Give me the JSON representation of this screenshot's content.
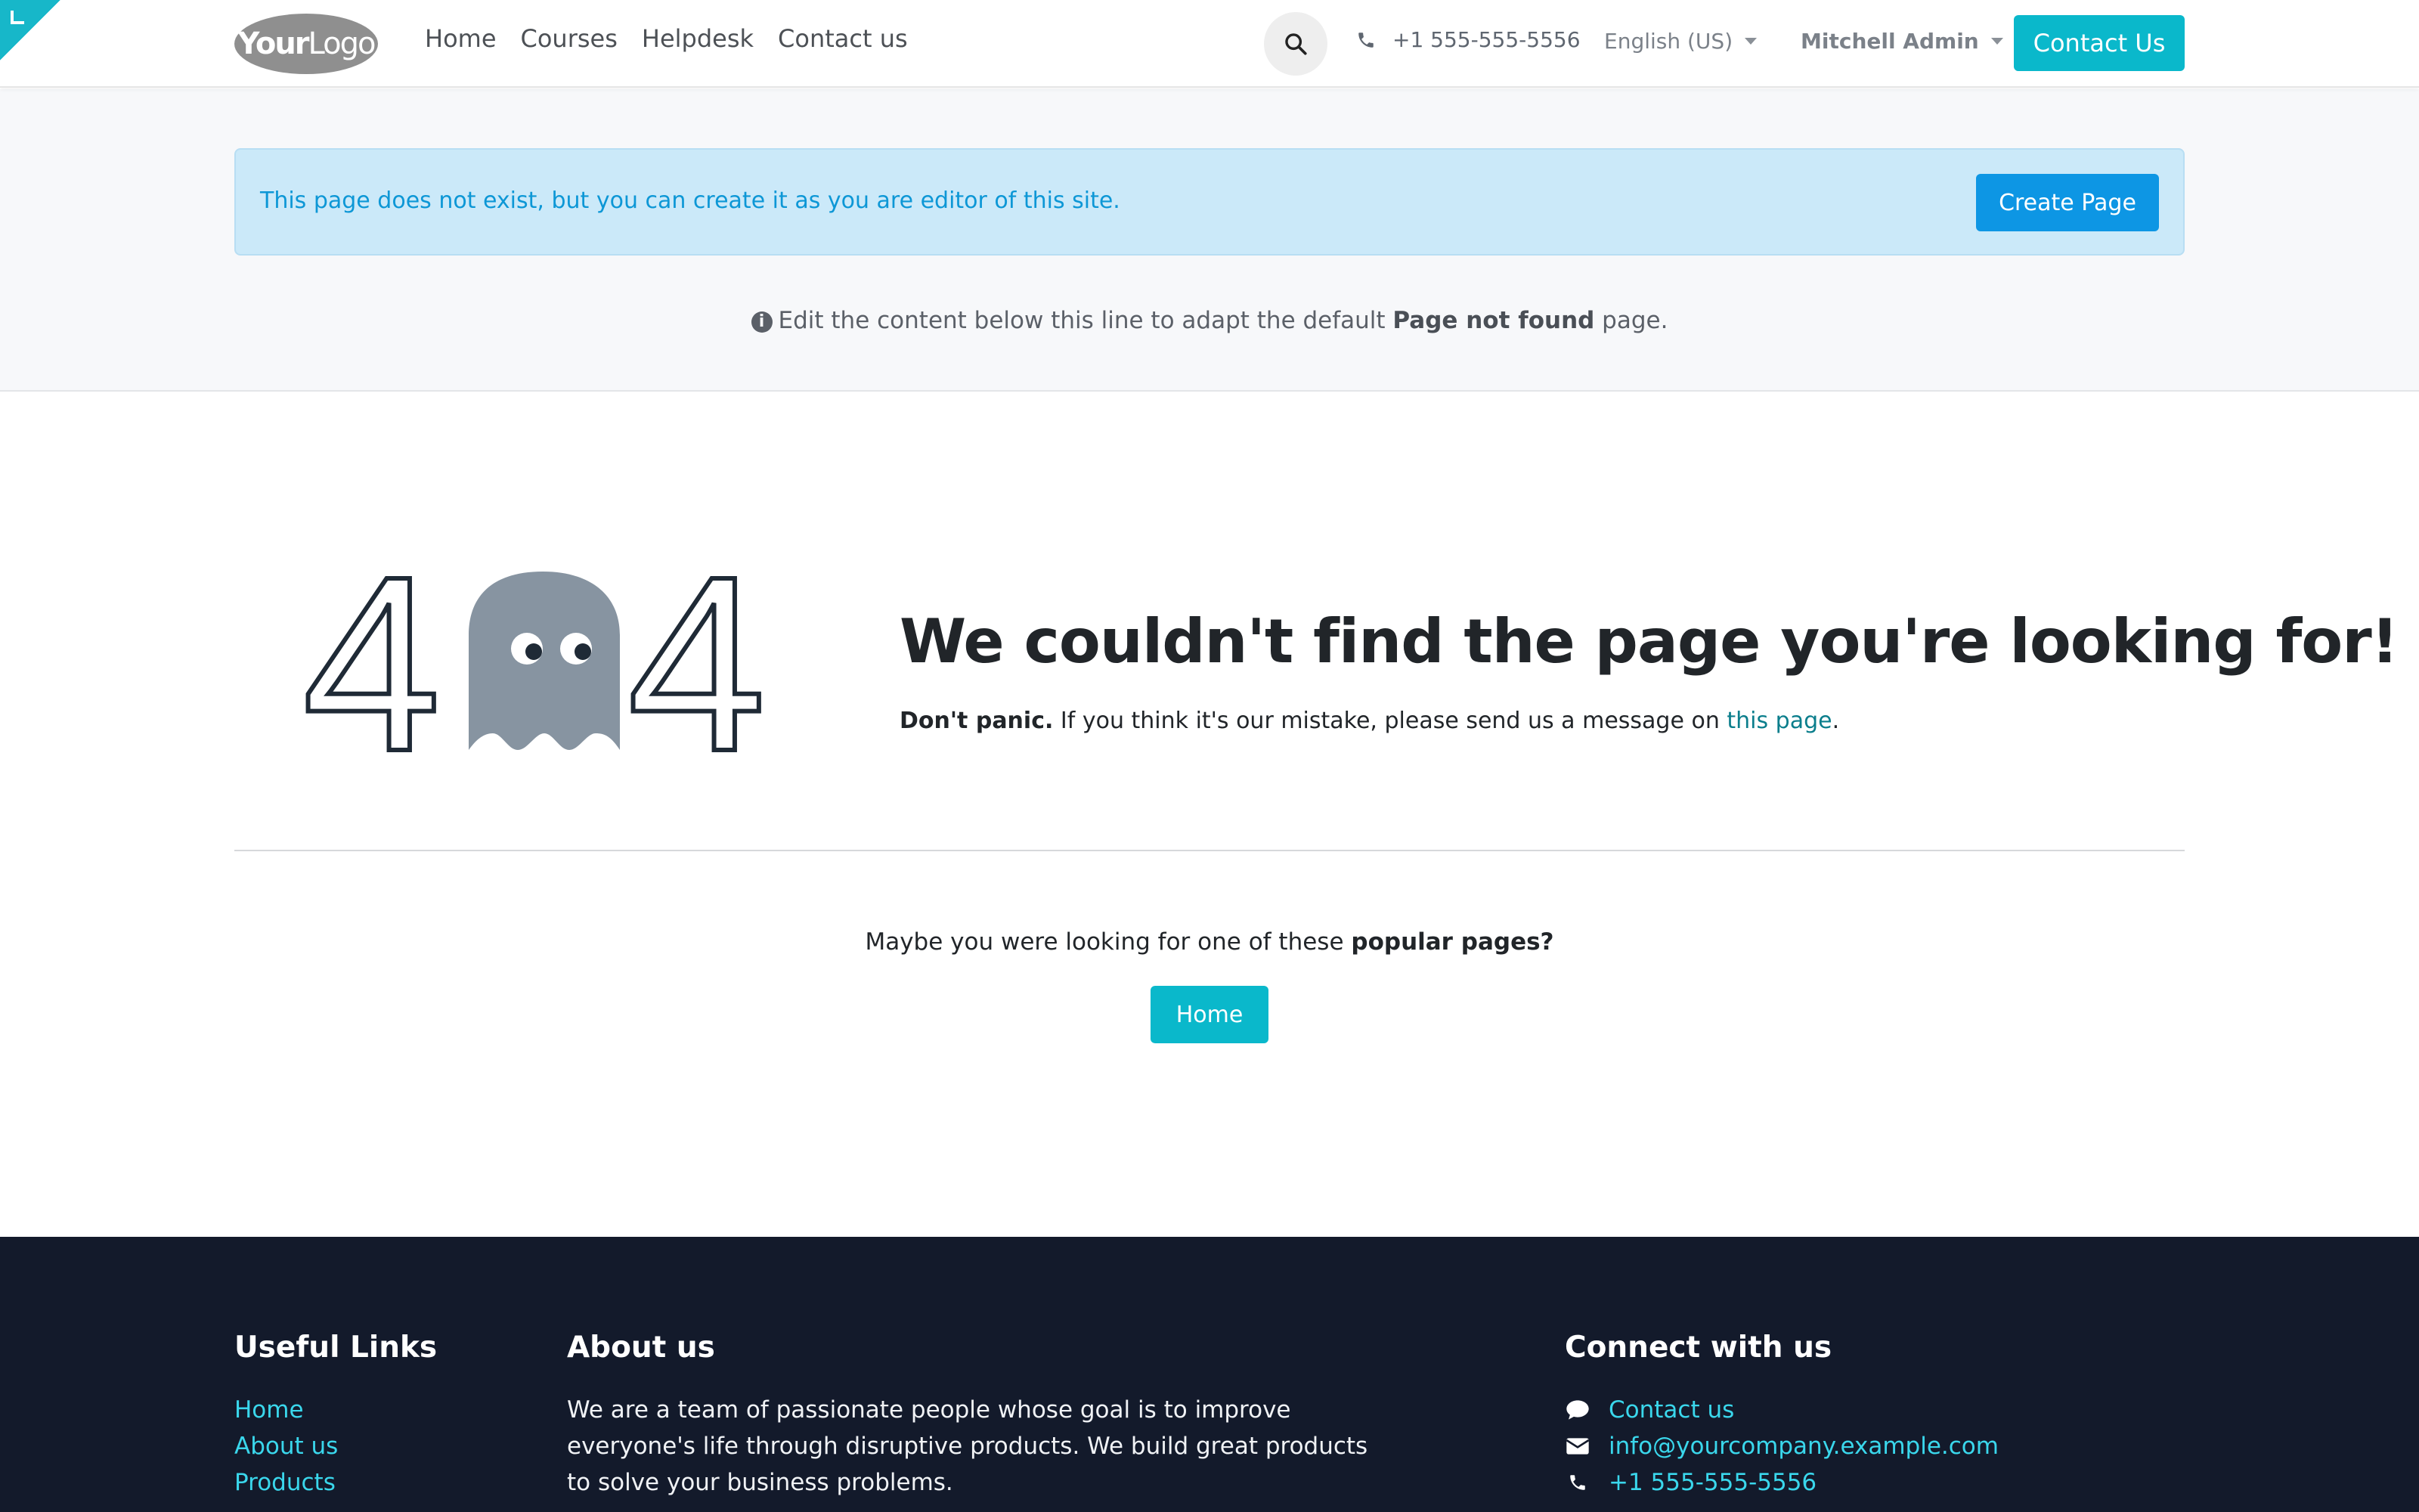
{
  "header": {
    "logo": {
      "bold": "Your",
      "thin": "Logo"
    },
    "nav": [
      "Home",
      "Courses",
      "Helpdesk",
      "Contact us"
    ],
    "phone": "+1 555-555-5556",
    "language": "English (US)",
    "user": "Mitchell Admin",
    "cta": "Contact Us"
  },
  "editor": {
    "alert_message": "This page does not exist, but you can create it as you are editor of this site.",
    "create_button": "Create Page",
    "hint_before": "Edit the content below this line to adapt the default ",
    "hint_bold": "Page not found",
    "hint_after": " page."
  },
  "notfound": {
    "digits": [
      "4",
      "4"
    ],
    "headline": "We couldn't find the page you're looking for!",
    "sub_bold": "Don't panic.",
    "sub_text": " If you think it's our mistake, please send us a message on ",
    "sub_link": "this page",
    "sub_end": "."
  },
  "popular": {
    "text": "Maybe you were looking for one of these ",
    "bold": "popular pages?",
    "button": "Home"
  },
  "footer": {
    "useful_links": {
      "title": "Useful Links",
      "items": [
        "Home",
        "About us",
        "Products"
      ]
    },
    "about": {
      "title": "About us",
      "text": "We are a team of passionate people whose goal is to improve everyone's life through disruptive products. We build great products to solve your business problems."
    },
    "connect": {
      "title": "Connect with us",
      "contact": "Contact us",
      "email": "info@yourcompany.example.com",
      "phone": "+1 555-555-5556"
    }
  },
  "colors": {
    "accent": "#0ab8cb",
    "create_button": "#0d96e4",
    "alert_bg": "#cbe9f9",
    "footer_bg": "#131a2b",
    "footer_link": "#3ad7ec",
    "ghost": "#8794a1"
  },
  "icons": [
    "edit-corner-icon",
    "search-icon",
    "phone-icon",
    "info-circle-icon",
    "ghost-icon",
    "comment-icon",
    "envelope-icon"
  ]
}
